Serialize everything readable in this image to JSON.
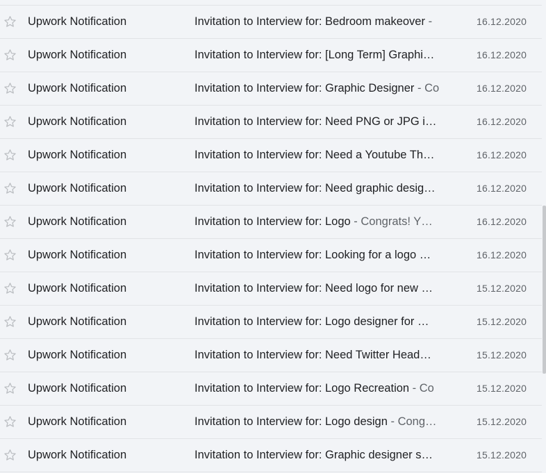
{
  "inbox": {
    "rows": [
      {
        "sender": "Upwork Notification",
        "subject": "Invitation to Interview for: Bedroom makeover",
        "snippet": " - ",
        "date": "16.12.2020"
      },
      {
        "sender": "Upwork Notification",
        "subject": "Invitation to Interview for: [Long Term] Graphi…",
        "snippet": "",
        "date": "16.12.2020"
      },
      {
        "sender": "Upwork Notification",
        "subject": "Invitation to Interview for: Graphic Designer",
        "snippet": " - Co",
        "date": "16.12.2020"
      },
      {
        "sender": "Upwork Notification",
        "subject": "Invitation to Interview for: Need PNG or JPG i…",
        "snippet": "",
        "date": "16.12.2020"
      },
      {
        "sender": "Upwork Notification",
        "subject": "Invitation to Interview for: Need a Youtube Th…",
        "snippet": "",
        "date": "16.12.2020"
      },
      {
        "sender": "Upwork Notification",
        "subject": "Invitation to Interview for: Need graphic desig…",
        "snippet": "",
        "date": "16.12.2020"
      },
      {
        "sender": "Upwork Notification",
        "subject": "Invitation to Interview for: Logo",
        "snippet": " - Congrats! Y…",
        "date": "16.12.2020"
      },
      {
        "sender": "Upwork Notification",
        "subject": "Invitation to Interview for: Looking for a logo …",
        "snippet": "",
        "date": "16.12.2020"
      },
      {
        "sender": "Upwork Notification",
        "subject": "Invitation to Interview for: Need logo for new …",
        "snippet": "",
        "date": "15.12.2020"
      },
      {
        "sender": "Upwork Notification",
        "subject": "Invitation to Interview for: Logo designer for …",
        "snippet": "",
        "date": "15.12.2020"
      },
      {
        "sender": "Upwork Notification",
        "subject": "Invitation to Interview for: Need Twitter Head…",
        "snippet": "",
        "date": "15.12.2020"
      },
      {
        "sender": "Upwork Notification",
        "subject": "Invitation to Interview for: Logo Recreation",
        "snippet": " - Co",
        "date": "15.12.2020"
      },
      {
        "sender": "Upwork Notification",
        "subject": "Invitation to Interview for: Logo design",
        "snippet": " - Cong…",
        "date": "15.12.2020"
      },
      {
        "sender": "Upwork Notification",
        "subject": "Invitation to Interview for: Graphic designer s…",
        "snippet": "",
        "date": "15.12.2020"
      }
    ]
  },
  "icons": {
    "star": "star-outline-icon"
  },
  "colors": {
    "background": "#f2f4f7",
    "divider": "#e1e3e6",
    "text_primary": "#202124",
    "text_secondary": "#5f6368",
    "star": "#b9bcc0"
  }
}
